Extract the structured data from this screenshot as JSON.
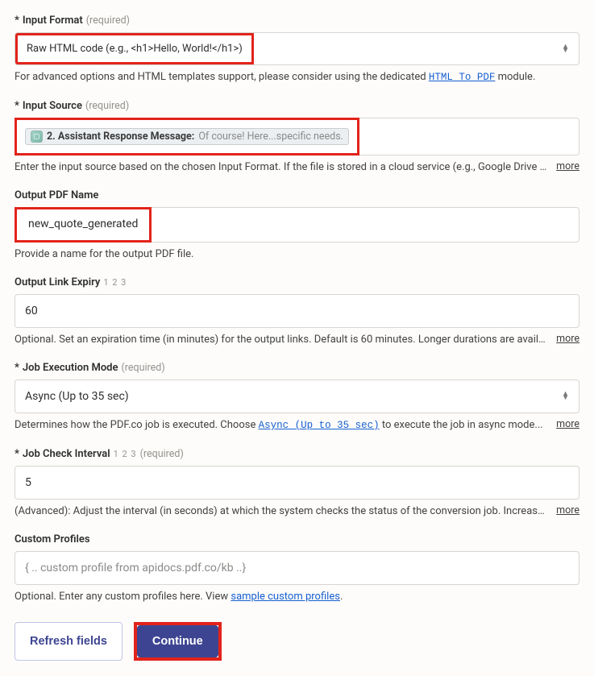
{
  "inputFormat": {
    "label": "Input Format",
    "required": "(required)",
    "value": "Raw HTML code (e.g., <h1>Hello, World!</h1>)",
    "helperPrefix": "For advanced options and HTML templates support, please consider using the dedicated ",
    "helperLink": "HTML To PDF",
    "helperSuffix": " module."
  },
  "inputSource": {
    "label": "Input Source",
    "required": "(required)",
    "pill": {
      "bold": "2. Assistant Response Message:",
      "faded": " Of course! Here...specific needs."
    },
    "helper": "Enter the input source based on the chosen Input Format. If the file is stored in a cloud service (e.g., Google Drive or..."
  },
  "outputName": {
    "label": "Output PDF Name",
    "value": "new_quote_generated",
    "helper": "Provide a name for the output PDF file."
  },
  "linkExpiry": {
    "label": "Output Link Expiry",
    "num": "1 2 3",
    "value": "60",
    "helper": "Optional. Set an expiration time (in minutes) for the output links. Default is 60 minutes. Longer durations are available..."
  },
  "jobMode": {
    "label": "Job Execution Mode",
    "required": "(required)",
    "value": "Async (Up to 35 sec)",
    "helperPrefix": "Determines how the PDF.co job is executed. Choose ",
    "helperLink": "Async (Up to 35 sec)",
    "helperSuffix": " to execute the job in async mode..."
  },
  "jobInterval": {
    "label": "Job Check Interval",
    "num": "1 2 3",
    "required": "(required)",
    "value": "5",
    "helper": "(Advanced): Adjust the interval (in seconds) at which the system checks the status of the conversion job. Increase th..."
  },
  "customProfiles": {
    "label": "Custom Profiles",
    "placeholder": "{ .. custom profile from apidocs.pdf.co/kb ..}",
    "helperPrefix": "Optional. Enter any custom profiles here. View ",
    "helperLink": "sample custom profiles",
    "helperSuffix": "."
  },
  "more": "more",
  "buttons": {
    "refresh": "Refresh fields",
    "continue": "Continue"
  }
}
